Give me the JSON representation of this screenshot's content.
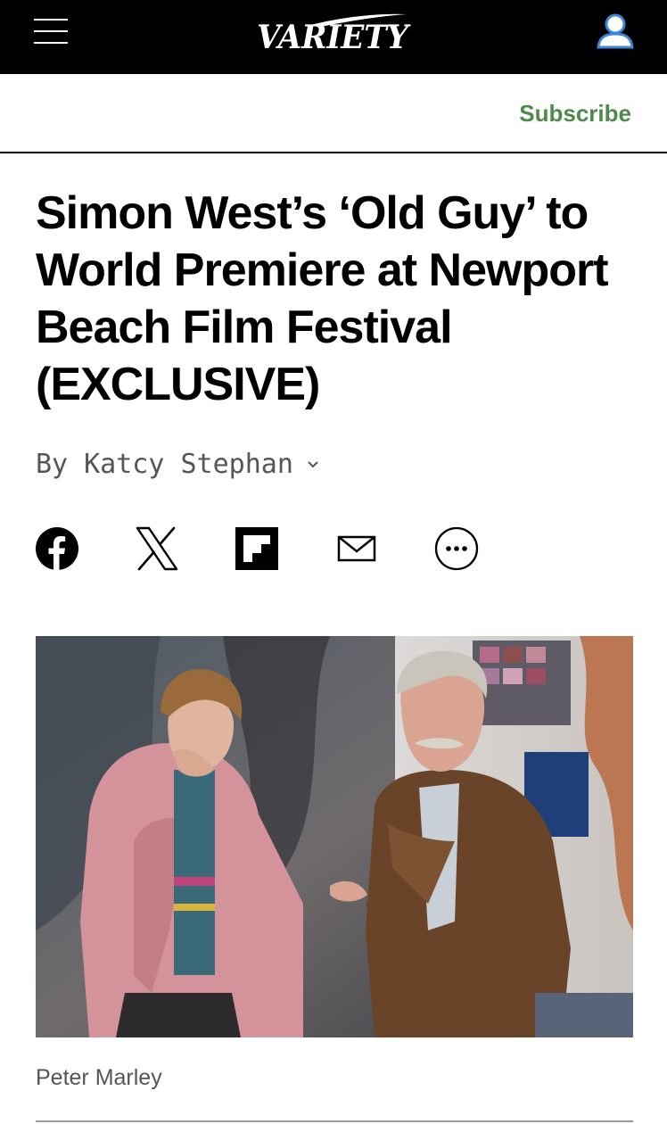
{
  "header": {
    "logo_text": "VARIETY",
    "subscribe_label": "Subscribe"
  },
  "article": {
    "headline": "Simon West’s ‘Old Guy’ to World Premiere at Newport Beach Film Festival (EXCLUSIVE)",
    "byline_prefix": "By",
    "author": "Katcy Stephan",
    "photo_credit": "Peter Marley"
  },
  "share_icons": [
    "facebook-icon",
    "x-icon",
    "flipboard-icon",
    "email-icon",
    "more-icon"
  ],
  "colors": {
    "header_bg": "#000000",
    "subscribe": "#4e8a49",
    "account_icon": "#3d86d8",
    "text": "#000000",
    "muted": "#555555"
  }
}
